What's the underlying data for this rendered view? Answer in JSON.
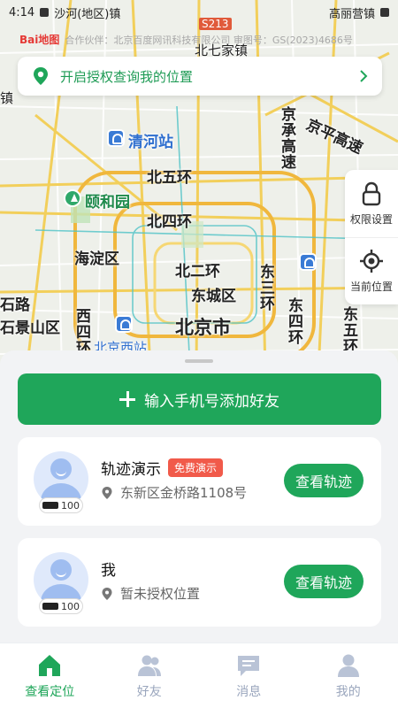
{
  "status_bar": {
    "time": "4:14",
    "left_text": "沙河(地区)镇",
    "right_text": "高丽营镇"
  },
  "map": {
    "copyright": "合作伙伴：北京百度网讯科技有限公司 审图号：GS(2023)4686号",
    "logo": "Bai地图",
    "labels": {
      "beiqijia": "北七家镇",
      "s213": "S213",
      "qinghe_station": "清河站",
      "jingcheng": "京承高速",
      "jingping": "京平高速",
      "bei_wuhuan": "北五环",
      "yiheyuan": "颐和园",
      "bei_sihuan": "北四环",
      "haidian": "海淀区",
      "bei_erhuan": "北二环",
      "dong_sanhuan": "东三环",
      "dongcheng": "东城区",
      "shijingshan": "石景山区",
      "xi_sihuan": "西四环",
      "beijing": "北京市",
      "dong_sihuan": "东四环",
      "dong_wuhuan": "东五环",
      "beijing_west": "北京西站",
      "shilu": "石路",
      "zhen": "镇"
    }
  },
  "banner": {
    "text": "开启授权查询我的位置"
  },
  "side_controls": {
    "permission": "权限设置",
    "current_location": "当前位置"
  },
  "sheet": {
    "add_friend_label": "输入手机号添加好友",
    "friends": [
      {
        "name": "轨迹演示",
        "tag": "免费演示",
        "location": "东新区金桥路1108号",
        "battery": "100",
        "action": "查看轨迹"
      },
      {
        "name": "我",
        "tag": "",
        "location": "暂未授权位置",
        "battery": "100",
        "action": "查看轨迹"
      }
    ]
  },
  "tabs": [
    {
      "label": "查看定位",
      "icon": "home-icon"
    },
    {
      "label": "好友",
      "icon": "friends-icon"
    },
    {
      "label": "消息",
      "icon": "message-icon"
    },
    {
      "label": "我的",
      "icon": "profile-icon"
    }
  ],
  "colors": {
    "accent": "#1fa65a",
    "tag_red": "#f15a4a",
    "tab_inactive": "#9aa6bd"
  }
}
